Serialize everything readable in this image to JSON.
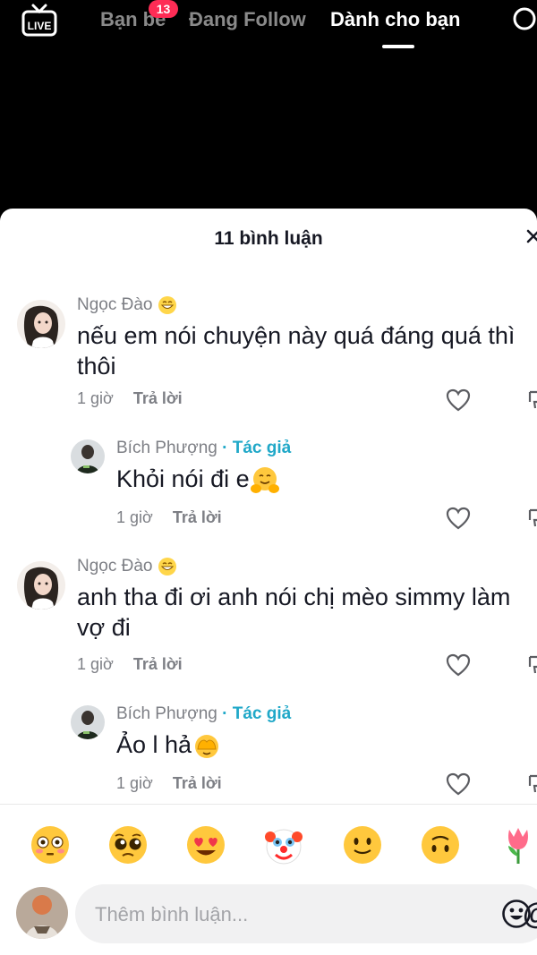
{
  "nav": {
    "live_label": "LIVE",
    "tabs": [
      {
        "label": "Bạn bè",
        "badge": "13"
      },
      {
        "label": "Đang Follow"
      },
      {
        "label": "Dành cho bạn",
        "active": true
      }
    ]
  },
  "comments_sheet": {
    "title": "11 bình luận",
    "comments": [
      {
        "username": "Ngọc Đào",
        "text": "nếu em nói chuyện này quá đáng quá thì thôi",
        "time": "1 giờ",
        "reply_label": "Trả lời"
      },
      {
        "username": "Bích Phượng",
        "author_tag": "· Tác giả",
        "text": "Khỏi nói đi e",
        "emoji": "hugging-face",
        "time": "1 giờ",
        "reply_label": "Trả lời"
      },
      {
        "username": "Ngọc Đào",
        "text": "anh tha đi ơi anh nói chị mèo simmy làm vợ đi",
        "time": "1 giờ",
        "reply_label": "Trả lời"
      },
      {
        "username": "Bích Phượng",
        "author_tag": "· Tác giả",
        "text": "Ảo l hả",
        "emoji": "face-with-hand-over-eyes",
        "time": "1 giờ",
        "reply_label": "Trả lời"
      }
    ]
  },
  "emoji_bar": [
    "flushed-face",
    "pleading-face",
    "heart-eyes-face",
    "clown-face",
    "slightly-smiling-face",
    "upside-down-face",
    "tulip"
  ],
  "input": {
    "placeholder": "Thêm bình luận..."
  },
  "colors": {
    "badge": "#fe2c55",
    "author_tag": "#20a8c8",
    "text": "#161823",
    "muted": "#7d7f85"
  }
}
